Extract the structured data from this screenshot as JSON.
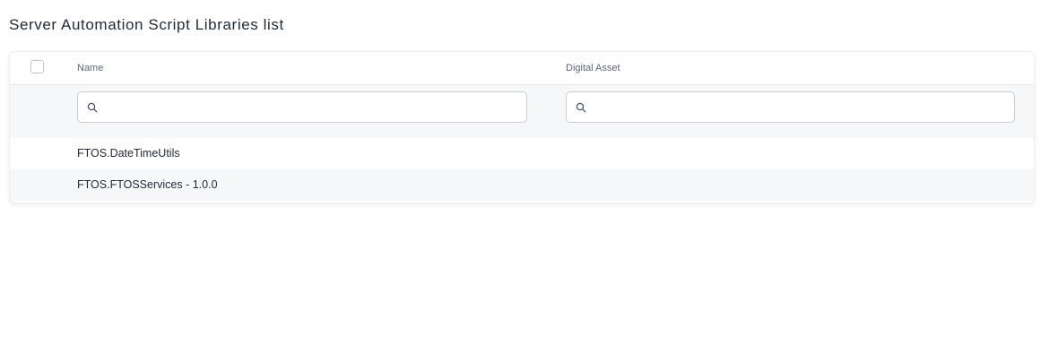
{
  "page": {
    "title": "Server Automation Script Libraries list"
  },
  "table": {
    "columns": [
      {
        "label": "Name"
      },
      {
        "label": "Digital Asset"
      }
    ],
    "filters": [
      {
        "value": "",
        "icon": "search-icon"
      },
      {
        "value": "",
        "icon": "search-icon"
      }
    ],
    "rows": [
      {
        "name": "FTOS.DateTimeUtils",
        "digital_asset": ""
      },
      {
        "name": "FTOS.FTOSServices - 1.0.0",
        "digital_asset": ""
      }
    ]
  },
  "colors": {
    "border": "#e5e7eb",
    "row_alt": "#f6f7f9",
    "text": "#1f2937",
    "header_text": "#5f6673"
  }
}
